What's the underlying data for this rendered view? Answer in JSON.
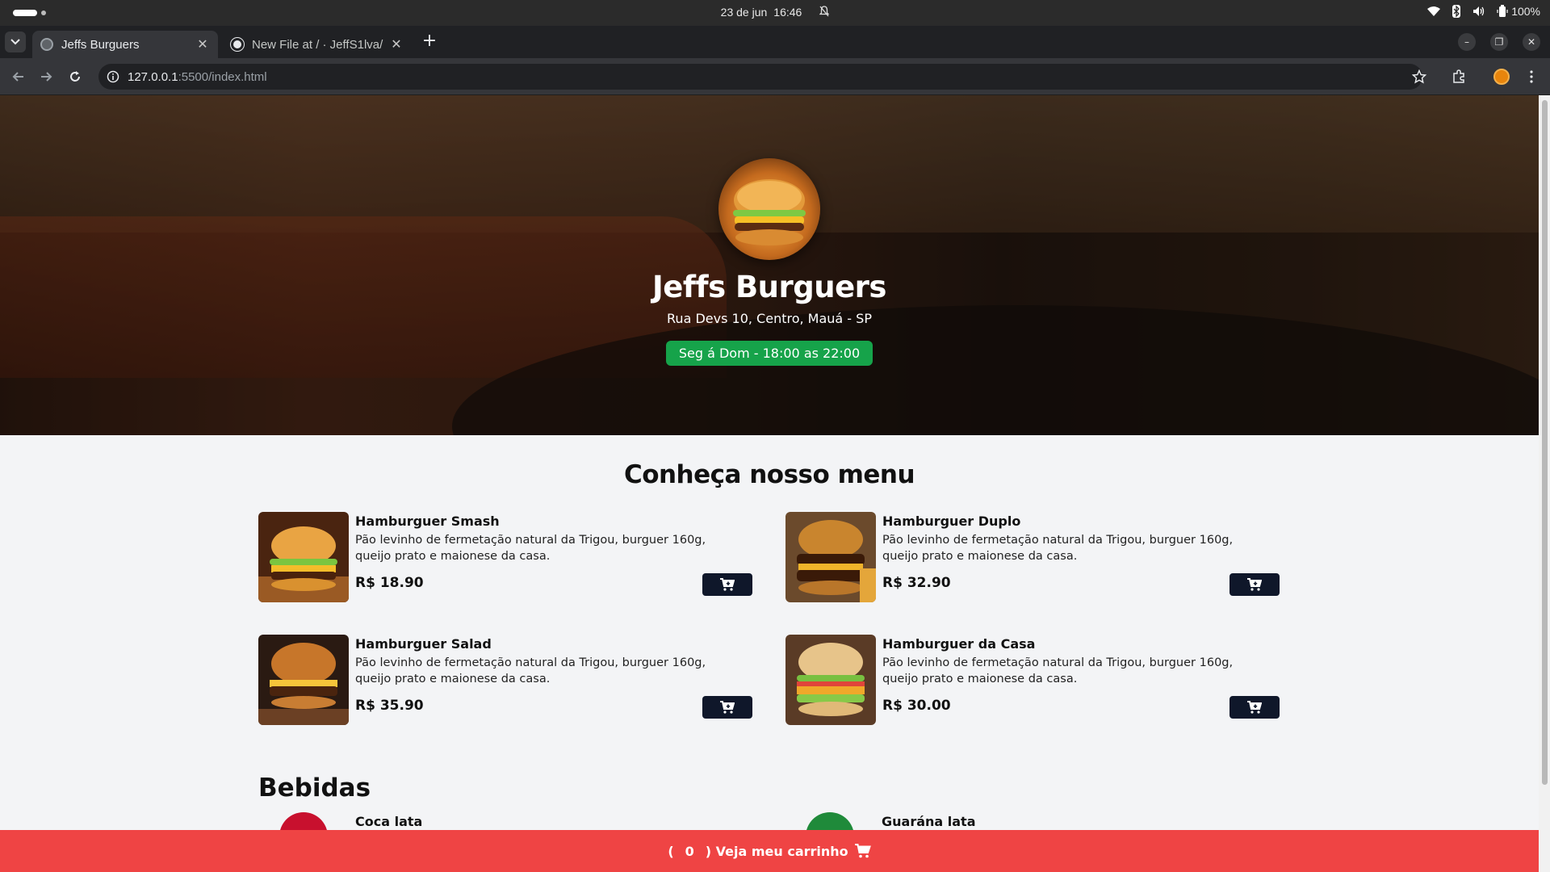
{
  "system": {
    "date": "23 de jun",
    "time": "16:46",
    "battery": "100%"
  },
  "browser": {
    "tabs": [
      {
        "title": "Jeffs Burguers",
        "active": true
      },
      {
        "title": "New File at / · JeffS1lva/",
        "active": false
      }
    ],
    "url_host": "127.0.0.1",
    "url_path": ":5500/index.html"
  },
  "hero": {
    "title": "Jeffs Burguers",
    "address": "Rua Devs 10, Centro, Mauá - SP",
    "hours": "Seg á Dom - 18:00 as 22:00"
  },
  "menu": {
    "title": "Conheça nosso menu",
    "items": [
      {
        "name": "Hamburguer Smash",
        "desc": "Pão levinho de fermetação natural da Trigou, burguer 160g, queijo prato e maionese da casa.",
        "price": "R$ 18.90"
      },
      {
        "name": "Hamburguer Duplo",
        "desc": "Pão levinho de fermetação natural da Trigou, burguer 160g, queijo prato e maionese da casa.",
        "price": "R$ 32.90"
      },
      {
        "name": "Hamburguer Salad",
        "desc": "Pão levinho de fermetação natural da Trigou, burguer 160g, queijo prato e maionese da casa.",
        "price": "R$ 35.90"
      },
      {
        "name": "Hamburguer da Casa",
        "desc": "Pão levinho de fermetação natural da Trigou, burguer 160g, queijo prato e maionese da casa.",
        "price": "R$ 30.00"
      }
    ]
  },
  "drinks": {
    "title": "Bebidas",
    "items": [
      {
        "name": "Coca lata"
      },
      {
        "name": "Guarána lata"
      }
    ]
  },
  "cart": {
    "open_paren": "(",
    "count": "0",
    "label": ") Veja meu carrinho"
  },
  "colors": {
    "hours_badge": "#16a34a",
    "cart_bar": "#ef4444",
    "add_button": "#0f172a"
  }
}
